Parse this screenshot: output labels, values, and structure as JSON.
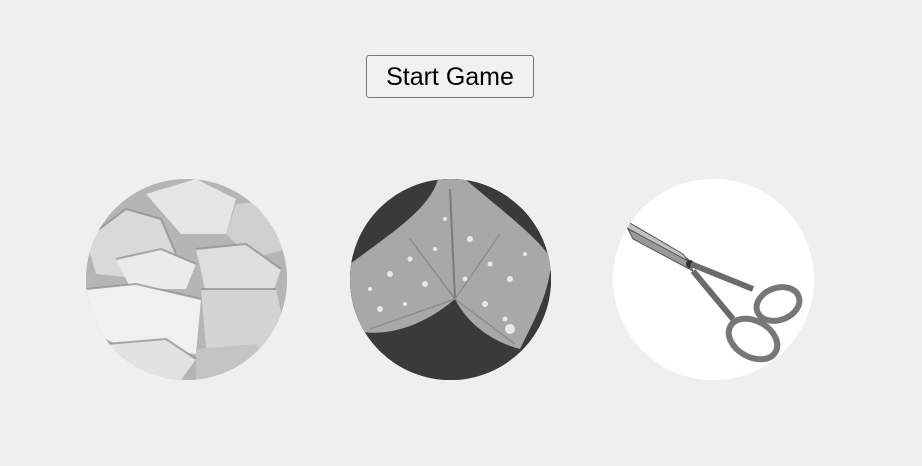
{
  "controls": {
    "start_label": "Start Game"
  },
  "choices": [
    {
      "id": "rock",
      "icon": "rock-icon"
    },
    {
      "id": "paper",
      "icon": "paper-icon"
    },
    {
      "id": "scissors",
      "icon": "scissors-icon"
    }
  ],
  "colors": {
    "page_background": "#efefef",
    "button_border": "#767676"
  }
}
